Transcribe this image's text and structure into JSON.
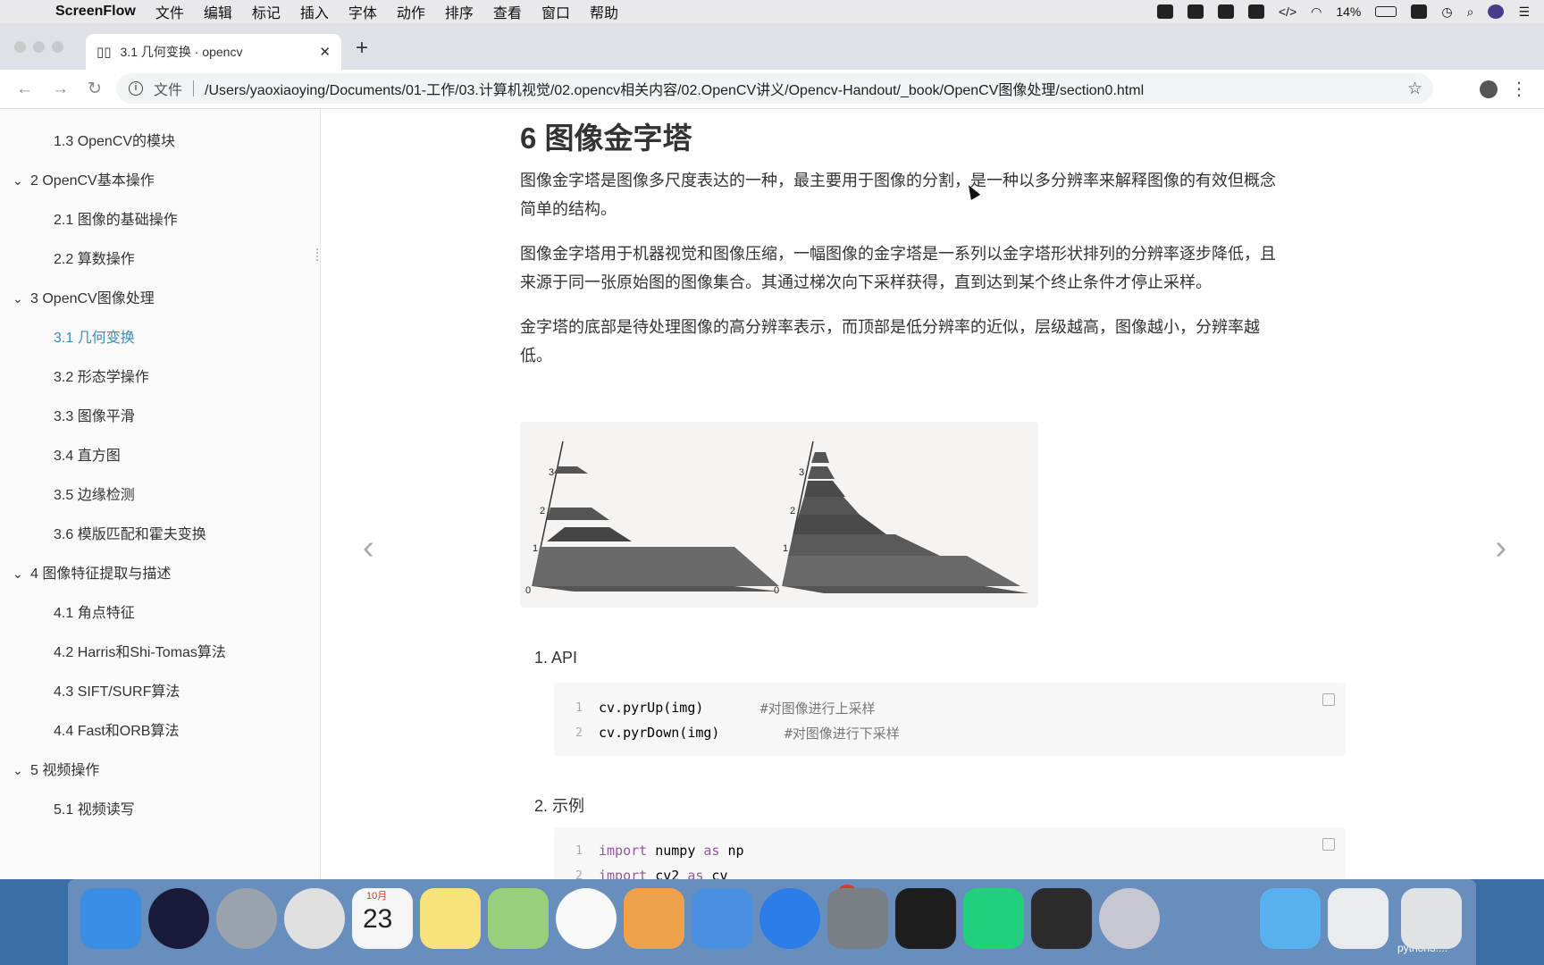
{
  "menubar": {
    "app": "ScreenFlow",
    "items": [
      "文件",
      "编辑",
      "标记",
      "插入",
      "字体",
      "动作",
      "排序",
      "查看",
      "窗口",
      "帮助"
    ],
    "battery": "14%"
  },
  "browser": {
    "tab_title": "3.1 几何变换 · opencv",
    "file_label": "文件",
    "url": "/Users/yaoxiaoying/Documents/01-工作/03.计算机视觉/02.opencv相关内容/02.OpenCV讲义/Opencv-Handout/_book/OpenCV图像处理/section0.html"
  },
  "sidebar": {
    "items": [
      {
        "label": "1.3 OpenCV的模块",
        "level": 2
      },
      {
        "label": "2 OpenCV基本操作",
        "level": 1
      },
      {
        "label": "2.1 图像的基础操作",
        "level": 2
      },
      {
        "label": "2.2 算数操作",
        "level": 2
      },
      {
        "label": "3 OpenCV图像处理",
        "level": 1
      },
      {
        "label": "3.1 几何变换",
        "level": 2
      },
      {
        "label": "3.2 形态学操作",
        "level": 2
      },
      {
        "label": "3.3 图像平滑",
        "level": 2
      },
      {
        "label": "3.4 直方图",
        "level": 2
      },
      {
        "label": "3.5 边缘检测",
        "level": 2
      },
      {
        "label": "3.6 模版匹配和霍夫变换",
        "level": 2
      },
      {
        "label": "4 图像特征提取与描述",
        "level": 1
      },
      {
        "label": "4.1 角点特征",
        "level": 2
      },
      {
        "label": "4.2 Harris和Shi-Tomas算法",
        "level": 2
      },
      {
        "label": "4.3 SIFT/SURF算法",
        "level": 2
      },
      {
        "label": "4.4 Fast和ORB算法",
        "level": 2
      },
      {
        "label": "5 视频操作",
        "level": 1
      },
      {
        "label": "5.1 视频读写",
        "level": 2
      }
    ]
  },
  "content": {
    "heading": "6 图像金字塔",
    "p1a": "图像金字塔是图像多尺度表达的一种，最主要用于图像的分割，是一种以多分辨率来解释图像的有效但概念",
    "p1b": "简单的结构。",
    "p2a": "图像金字塔用于机器视觉和图像压缩，一幅图像的金字塔是一系列以金字塔形状排列的分辨率逐步降低，且",
    "p2b": "来源于同一张原始图的图像集合。其通过梯次向下采样获得，直到达到某个终止条件才停止采样。",
    "p3a": "金字塔的底部是待处理图像的高分辨率表示，而顶部是低分辨率的近似，层级越高，图像越小，分辨率越",
    "p3b": "低。",
    "figure_labels": [
      "0",
      "1",
      "2",
      "3"
    ],
    "section1": "1. API",
    "api_code": [
      {
        "n": "1",
        "code": "cv.pyrUp(img)       ",
        "comment": "#对图像进行上采样"
      },
      {
        "n": "2",
        "code": "cv.pyrDown(img)        ",
        "comment": "#对图像进行下采样"
      }
    ],
    "section2": "2. 示例",
    "example_code": [
      {
        "n": "1",
        "kw": "import",
        "rest": " numpy ",
        "kw2": "as",
        "rest2": " np"
      },
      {
        "n": "2",
        "kw": "import",
        "rest": " cv2 ",
        "kw2": "as",
        "rest2": " cv"
      }
    ]
  },
  "dock": {
    "calendar_month": "10月",
    "calendar_day": "23",
    "appstore_badge": "6",
    "last_label": "python3...."
  }
}
